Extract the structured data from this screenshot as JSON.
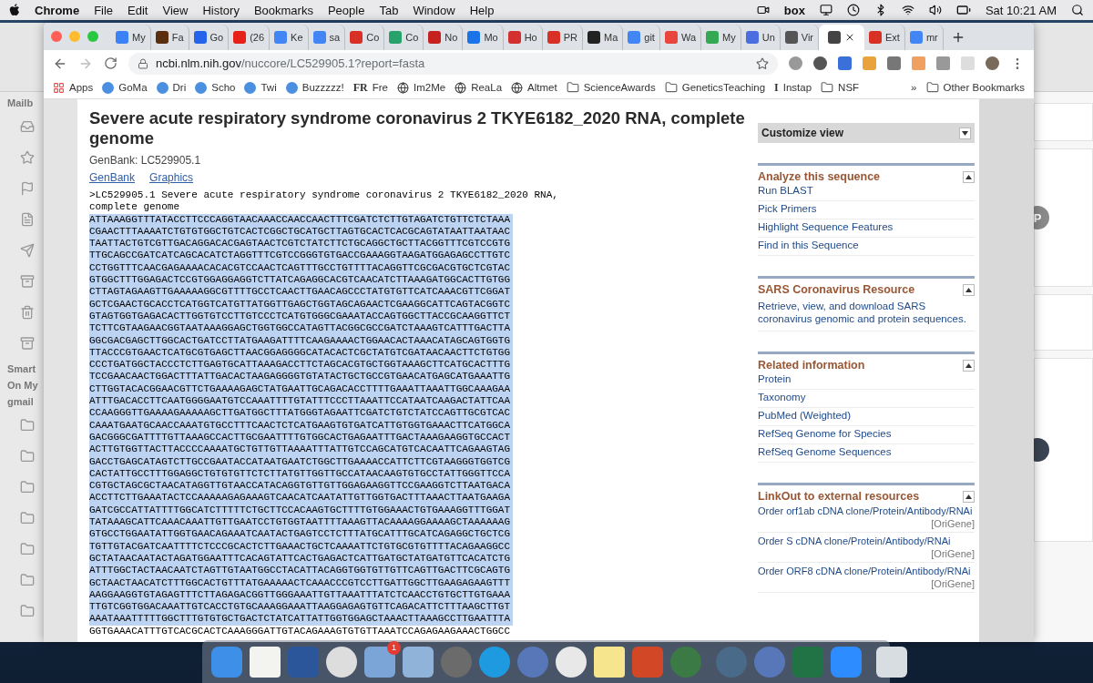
{
  "menu_bar": {
    "app": "Chrome",
    "items": [
      "File",
      "Edit",
      "View",
      "History",
      "Bookmarks",
      "People",
      "Tab",
      "Window",
      "Help"
    ],
    "status_text": "box",
    "clock": "Sat 10:21 AM"
  },
  "mail_sidebar": {
    "labels": [
      "Mailb",
      "Smart",
      "On My",
      "gmail"
    ]
  },
  "mail_list": {
    "avatar_letter": "P"
  },
  "browser": {
    "tabs": [
      {
        "label": "My",
        "selected": false
      },
      {
        "label": "Fa",
        "selected": false
      },
      {
        "label": "Go",
        "selected": false
      },
      {
        "label": "(26",
        "selected": false
      },
      {
        "label": "Ke",
        "selected": false
      },
      {
        "label": "sa",
        "selected": false
      },
      {
        "label": "Co",
        "selected": false
      },
      {
        "label": "Co",
        "selected": false
      },
      {
        "label": "No",
        "selected": false
      },
      {
        "label": "Mo",
        "selected": false
      },
      {
        "label": "Ho",
        "selected": false
      },
      {
        "label": "PR",
        "selected": false
      },
      {
        "label": "Ma",
        "selected": false
      },
      {
        "label": "git",
        "selected": false
      },
      {
        "label": "Wa",
        "selected": false
      },
      {
        "label": "My",
        "selected": false
      },
      {
        "label": "Un",
        "selected": false
      },
      {
        "label": "Vir",
        "selected": false
      },
      {
        "selected": true
      },
      {
        "label": "Ext",
        "selected": false
      },
      {
        "label": "mr",
        "selected": false
      }
    ],
    "url_host": "ncbi.nlm.nih.gov",
    "url_path": "/nuccore/LC529905.1?report=fasta",
    "bookmarks": [
      {
        "label": "Apps",
        "kind": "apps"
      },
      {
        "label": "GoMa",
        "kind": "site"
      },
      {
        "label": "Dri",
        "kind": "site"
      },
      {
        "label": "Scho",
        "kind": "site"
      },
      {
        "label": "Twi",
        "kind": "site"
      },
      {
        "label": "Buzzzzz!",
        "kind": "site"
      },
      {
        "label": "Fre",
        "kind": "text_logo",
        "logo": "FR"
      },
      {
        "label": "Im2Me",
        "kind": "globe"
      },
      {
        "label": "ReaLa",
        "kind": "globe"
      },
      {
        "label": "Altmet",
        "kind": "globe"
      },
      {
        "label": "ScienceAwards",
        "kind": "folder"
      },
      {
        "label": "GeneticsTeaching",
        "kind": "folder"
      },
      {
        "label": "Instap",
        "kind": "text_logo",
        "logo": "I"
      },
      {
        "label": "NSF",
        "kind": "folder"
      }
    ],
    "more": "»",
    "other_bookmarks": "Other Bookmarks"
  },
  "page": {
    "title": "Severe acute respiratory syndrome coronavirus 2 TKYE6182_2020 RNA, complete genome",
    "subtitle": "GenBank: LC529905.1",
    "links": [
      "GenBank",
      "Graphics"
    ],
    "fasta_header": ">LC529905.1 Severe acute respiratory syndrome coronavirus 2 TKYE6182_2020 RNA, complete genome",
    "sequence": [
      {
        "text": "ATTAAAGGTTTATACCTTCCCAGGTAACAAACCAACCAACTTTCGATCTCTTGTAGATCTGTTCTCTAAA",
        "selected": true
      },
      {
        "text": "CGAACTTTAAAATCTGTGTGGCTGTCACTCGGCTGCATGCTTAGTGCACTCACGCAGTATAATTAATAAC",
        "selected": true
      },
      {
        "text": "TAATTACTGTCGTTGACAGGACACGAGTAACTCGTCTATCTTCTGCAGGCTGCTTACGGTTTCGTCCGTG",
        "selected": true
      },
      {
        "text": "TTGCAGCCGATCATCAGCACATCTAGGTTTCGTCCGGGTGTGACCGAAAGGTAAGATGGAGAGCCTTGTC",
        "selected": true
      },
      {
        "text": "CCTGGTTTCAACGAGAAAACACACGTCCAACTCAGTTTGCCTGTTTTACAGGTTCGCGACGTGCTCGTAC",
        "selected": true
      },
      {
        "text": "GTGGCTTTGGAGACTCCGTGGAGGAGGTCTTATCAGAGGCACGTCAACATCTTAAAGATGGCACTTGTGG",
        "selected": true
      },
      {
        "text": "CTTAGTAGAAGTTGAAAAAGGCGTTTTGCCTCAACTTGAACAGCCCTATGTGTTCATCAAACGTTCGGAT",
        "selected": true
      },
      {
        "text": "GCTCGAACTGCACCTCATGGTCATGTTATGGTTGAGCTGGTAGCAGAACTCGAAGGCATTCAGTACGGTC",
        "selected": true
      },
      {
        "text": "GTAGTGGTGAGACACTTGGTGTCCTTGTCCCTCATGTGGGCGAAATACCAGTGGCTTACCGCAAGGTTCT",
        "selected": true
      },
      {
        "text": "TCTTCGTAAGAACGGTAATAAAGGAGCTGGTGGCCATAGTTACGGCGCCGATCTAAAGTCATTTGACTTA",
        "selected": true
      },
      {
        "text": "GGCGACGAGCTTGGCACTGATCCTTATGAAGATTTTCAAGAAAACTGGAACACTAAACATAGCAGTGGTG",
        "selected": true
      },
      {
        "text": "TTACCCGTGAACTCATGCGTGAGCTTAACGGAGGGGCATACACTCGCTATGTCGATAACAACTTCTGTGG",
        "selected": true
      },
      {
        "text": "CCCTGATGGCTACCCTCTTGAGTGCATTAAAGACCTTCTAGCACGTGCTGGTAAAGCTTCATGCACTTTG",
        "selected": true
      },
      {
        "text": "TCCGAACAACTGGACTTTATTGACACTAAGAGGGGTGTATACTGCTGCCGTGAACATGAGCATGAAATTG",
        "selected": true
      },
      {
        "text": "CTTGGTACACGGAACGTTCTGAAAAGAGCTATGAATTGCAGACACCTTTTGAAATTAAATTGGCAAAGAA",
        "selected": true
      },
      {
        "text": "ATTTGACACCTTCAATGGGGAATGTCCAAATTTTGTATTTCCCTTAAATTCCATAATCAAGACTATTCAA",
        "selected": true
      },
      {
        "text": "CCAAGGGTTGAAAAGAAAAAGCTTGATGGCTTTATGGGTAGAATTCGATCTGTCTATCCAGTTGCGTCAC",
        "selected": true
      },
      {
        "text": "CAAATGAATGCAACCAAATGTGCCTTTCAACTCTCATGAAGTGTGATCATTGTGGTGAAACTTCATGGCA",
        "selected": true
      },
      {
        "text": "GACGGGCGATTTTGTTAAAGCCACTTGCGAATTTTGTGGCACTGAGAATTTGACTAAAGAAGGTGCCACT",
        "selected": true
      },
      {
        "text": "ACTTGTGGTTACTTACCCCAAAATGCTGTTGTTAAAATTTATTGTCCAGCATGTCACAATTCAGAAGTAG",
        "selected": true
      },
      {
        "text": "GACCTGAGCATAGTCTTGCCGAATACCATAATGAATCTGGCTTGAAAACCATTCTTCGTAAGGGTGGTCG",
        "selected": true
      },
      {
        "text": "CACTATTGCCTTTGGAGGCTGTGTGTTCTCTTATGTTGGTTGCCATAACAAGTGTGCCTATTGGGTTCCA",
        "selected": true
      },
      {
        "text": "CGTGCTAGCGCTAACATAGGTTGTAACCATACAGGTGTTGTTGGAGAAGGTTCCGAAGGTCTTAATGACA",
        "selected": true
      },
      {
        "text": "ACCTTCTTGAAATACTCCAAAAAGAGAAAGTCAACATCAATATTGTTGGTGACTTTAAACTTAATGAAGA",
        "selected": true
      },
      {
        "text": "GATCGCCATTATTTTGGCATCTTTTTCTGCTTCCACAAGTGCTTTTGTGGAAACTGTGAAAGGTTTGGAT",
        "selected": true
      },
      {
        "text": "TATAAAGCATTCAAACAAATTGTTGAATCCTGTGGTAATTTTAAAGTTACAAAAGGAAAAGCTAAAAAAG",
        "selected": true
      },
      {
        "text": "GTGCCTGGAATATTGGTGAACAGAAATCAATACTGAGTCCTCTTTATGCATTTGCATCAGAGGCTGCTCG",
        "selected": true
      },
      {
        "text": "TGTTGTACGATCAATTTTCTCCCGCACTCTTGAAACTGCTCAAAATTCTGTGCGTGTTTTACAGAAGGCC",
        "selected": true
      },
      {
        "text": "GCTATAACAATACTAGATGGAATTTCACAGTATTCACTGAGACTCATTGATGCTATGATGTTCACATCTG",
        "selected": true
      },
      {
        "text": "ATTTGGCTACTAACAATCTAGTTGTAATGGCCTACATTACAGGTGGTGTTGTTCAGTTGACTTCGCAGTG",
        "selected": true
      },
      {
        "text": "GCTAACTAACATCTTTGGCACTGTTTATGAAAAACTCAAACCCGTCCTTGATTGGCTTGAAGAGAAGTTT",
        "selected": true
      },
      {
        "text": "AAGGAAGGTGTAGAGTTTCTTAGAGACGGTTGGGAAATTGTTAAATTTATCTCAACCTGTGCTTGTGAAA",
        "selected": true
      },
      {
        "text": "TTGTCGGTGGACAAATTGTCACCTGTGCAAAGGAAATTAAGGAGAGTGTTCAGACATTCTTTAAGCTTGT",
        "selected": true
      },
      {
        "text": "AAATAAATTTTTGGCTTTGTGTGCTGACTCTATCATTATTGGTGGAGCTAAACTTAAAGCCTTGAATTTA",
        "selected": true
      },
      {
        "text": "GGTGAAACATTTGTCACGCACTCAAAGGGATTGTACAGAAAGTGTGTTAAATCCAGAGAAGAAACTGGCC",
        "selected": false
      }
    ]
  },
  "sidebar": {
    "customize": "Customize view",
    "sections": [
      {
        "title": "Analyze this sequence",
        "kind": "links",
        "items": [
          "Run BLAST",
          "Pick Primers",
          "Highlight Sequence Features",
          "Find in this Sequence"
        ]
      },
      {
        "title": "SARS Coronavirus Resource",
        "kind": "text",
        "text": "Retrieve, view, and download SARS coronavirus genomic and protein sequences."
      },
      {
        "title": "Related information",
        "kind": "links",
        "items": [
          "Protein",
          "Taxonomy",
          "PubMed (Weighted)",
          "RefSeq Genome for Species",
          "RefSeq Genome Sequences"
        ]
      },
      {
        "title": "LinkOut to external resources",
        "kind": "linkout",
        "items": [
          {
            "label": "Order orf1ab cDNA clone/Protein/Antibody/RNAi",
            "source": "[OriGene]"
          },
          {
            "label": "Order S cDNA clone/Protein/Antibody/RNAi",
            "source": "[OriGene]"
          },
          {
            "label": "Order ORF8 cDNA clone/Protein/Antibody/RNAi",
            "source": "[OriGene]"
          }
        ]
      }
    ]
  },
  "dock": {
    "badge": "1"
  }
}
